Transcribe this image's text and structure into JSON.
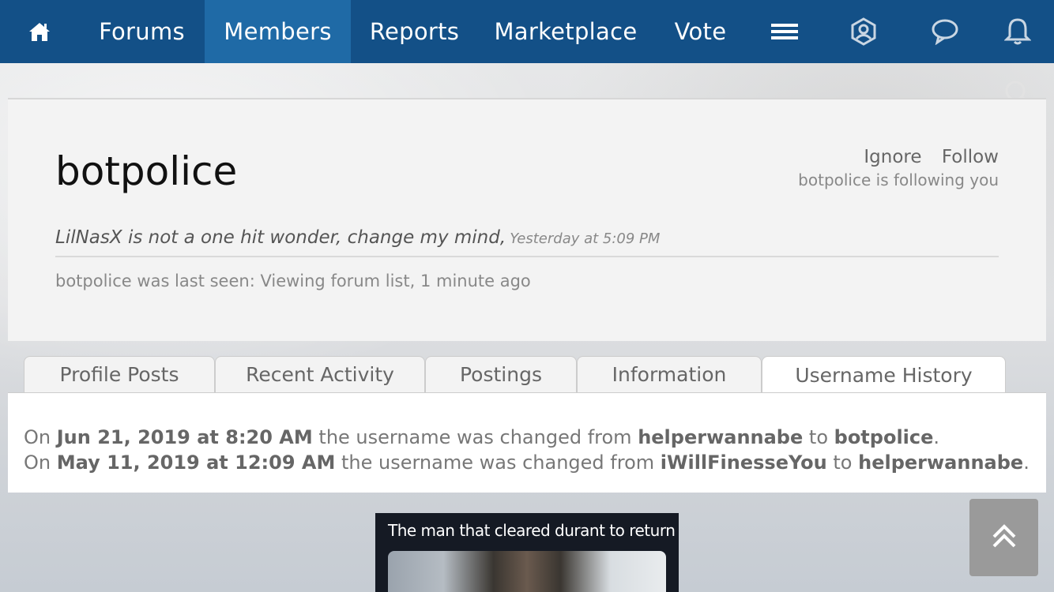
{
  "nav": {
    "items": [
      {
        "label": "Forums"
      },
      {
        "label": "Members"
      },
      {
        "label": "Reports"
      },
      {
        "label": "Marketplace"
      },
      {
        "label": "Vote"
      }
    ],
    "icons": [
      "home-icon",
      "menu-icon",
      "profile-icon",
      "chat-icon",
      "bell-icon"
    ],
    "active": "Members",
    "colors": {
      "bar": "#135087",
      "active": "#1f6aa6"
    }
  },
  "profile": {
    "username": "botpolice",
    "ignore_label": "Ignore",
    "follow_label": "Follow",
    "follows_you": "botpolice is following you",
    "status_message": "LilNasX is not a one hit wonder, change my mind,",
    "status_time": "Yesterday at 5:09 PM",
    "last_seen": "botpolice was last seen: Viewing forum list, 1 minute ago"
  },
  "tabs": [
    {
      "label": "Profile Posts"
    },
    {
      "label": "Recent Activity"
    },
    {
      "label": "Postings"
    },
    {
      "label": "Information"
    },
    {
      "label": "Username History"
    }
  ],
  "active_tab": "Username History",
  "history": [
    {
      "on": "On",
      "date": "Jun 21, 2019 at 8:20 AM",
      "mid": "the username was changed from",
      "from": "helperwannabe",
      "to_word": "to",
      "to": "botpolice",
      "end": "."
    },
    {
      "on": "On",
      "date": "May 11, 2019 at 12:09 AM",
      "mid": "the username was changed from",
      "from": "iWillFinesseYou",
      "to_word": "to",
      "to": "helperwannabe",
      "end": "."
    }
  ],
  "meme": {
    "caption": "The man that cleared durant to return"
  }
}
